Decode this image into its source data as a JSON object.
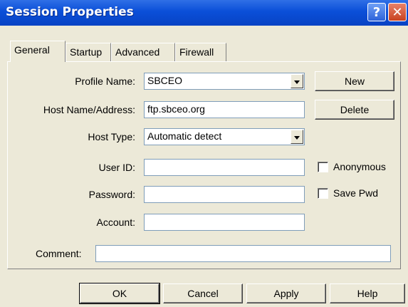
{
  "window": {
    "title": "Session Properties",
    "help_glyph": "?",
    "close_glyph": "✕"
  },
  "tabs": [
    {
      "label": "General",
      "active": true
    },
    {
      "label": "Startup",
      "active": false
    },
    {
      "label": "Advanced",
      "active": false
    },
    {
      "label": "Firewall",
      "active": false
    }
  ],
  "form": {
    "profile_name": {
      "label": "Profile Name:",
      "value": "SBCEO"
    },
    "host": {
      "label": "Host Name/Address:",
      "value": "ftp.sbceo.org"
    },
    "host_type": {
      "label": "Host Type:",
      "value": "Automatic detect"
    },
    "user_id": {
      "label": "User ID:",
      "value": ""
    },
    "password": {
      "label": "Password:",
      "value": ""
    },
    "account": {
      "label": "Account:",
      "value": ""
    },
    "comment": {
      "label": "Comment:",
      "value": ""
    },
    "anonymous": {
      "label": "Anonymous",
      "checked": false
    },
    "save_pwd": {
      "label": "Save Pwd",
      "checked": false
    }
  },
  "side_buttons": {
    "new": "New",
    "delete": "Delete"
  },
  "footer_buttons": {
    "ok": "OK",
    "cancel": "Cancel",
    "apply": "Apply",
    "help": "Help"
  },
  "colors": {
    "titlebar": "#0a4fd8",
    "face": "#ece9d8",
    "field_border": "#7f9db9"
  }
}
